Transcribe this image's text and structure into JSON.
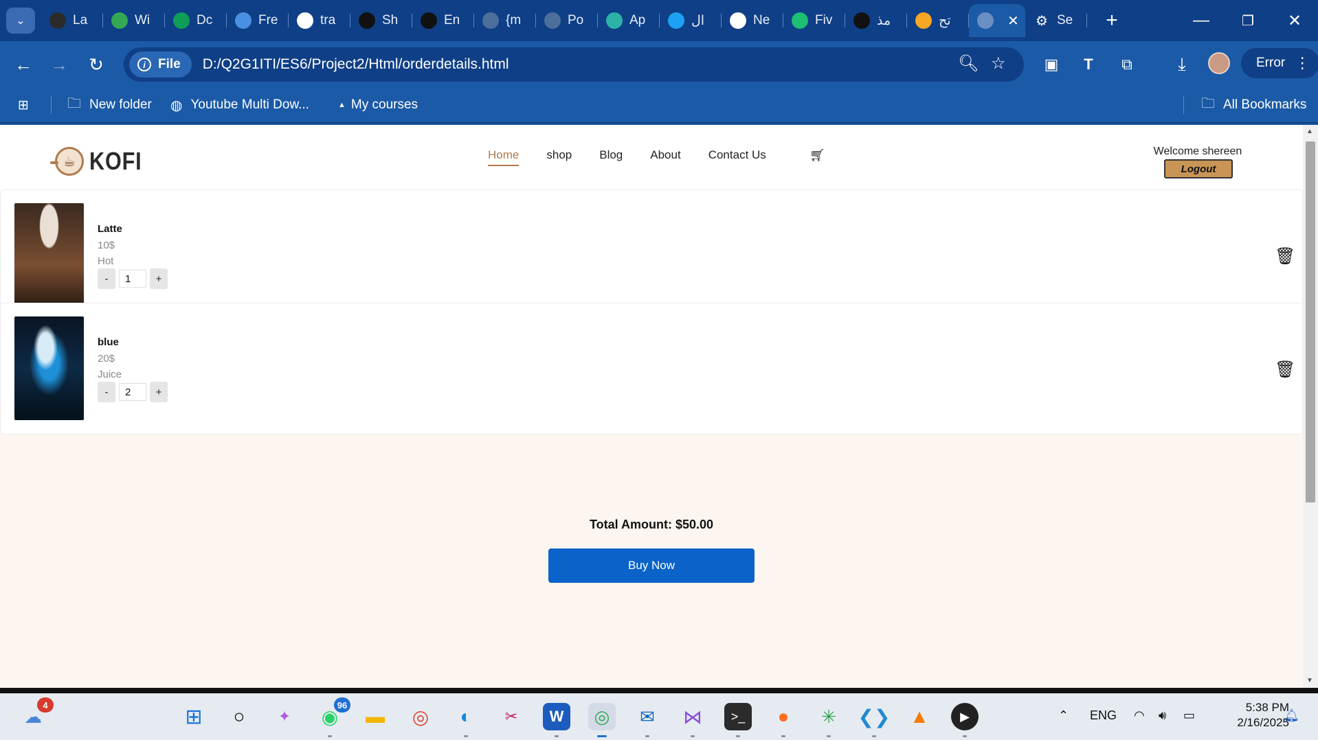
{
  "browser": {
    "tabs": [
      {
        "label": "La",
        "icon": "circle-icon",
        "color": "#2b2b2b"
      },
      {
        "label": "Wi",
        "icon": "drive-icon",
        "color": "#34a853"
      },
      {
        "label": "Dc",
        "icon": "plus-square-icon",
        "color": "#0f9d58"
      },
      {
        "label": "Fre",
        "icon": "doc-icon",
        "color": "#4a90e2"
      },
      {
        "label": "tra",
        "icon": "google-icon",
        "color": "#ffffff"
      },
      {
        "label": "Sh",
        "icon": "upwork-icon",
        "color": "#111111"
      },
      {
        "label": "En",
        "icon": "upwork-icon",
        "color": "#111111"
      },
      {
        "label": "{m",
        "icon": "globe-icon",
        "color": "#4d6f9c"
      },
      {
        "label": "Po",
        "icon": "globe-icon",
        "color": "#4d6f9c"
      },
      {
        "label": "Ap",
        "icon": "app-icon",
        "color": "#2bb3a8"
      },
      {
        "label": "ال",
        "icon": "ring-icon",
        "color": "#1da1f2"
      },
      {
        "label": "Ne",
        "icon": "chrome-icon",
        "color": "#ffffff"
      },
      {
        "label": "Fiv",
        "icon": "fiverr-icon",
        "color": "#1dbf73"
      },
      {
        "label": "مذ",
        "icon": "openai-icon",
        "color": "#111111"
      },
      {
        "label": "تح",
        "icon": "five-icon",
        "color": "#f5a623"
      }
    ],
    "active_tab_close": "✕",
    "extra_tab": "Se",
    "new_tab": "+",
    "address": {
      "site_info_label": "File",
      "url": "D:/Q2G1ITI/ES6/Project2/Html/orderdetails.html"
    },
    "error_label": "Error",
    "bookmarks": [
      {
        "label": "New folder",
        "icon": "folder-icon"
      },
      {
        "label": "Youtube Multi Dow...",
        "icon": "globe-icon"
      },
      {
        "label": "My courses",
        "icon": "triangle-icon"
      }
    ],
    "all_bookmarks": "All Bookmarks"
  },
  "site": {
    "logo_text": "KOFI",
    "nav": [
      "Home",
      "shop",
      "Blog",
      "About",
      "Contact Us"
    ],
    "welcome": "Welcome shereen",
    "logout": "Logout"
  },
  "order": {
    "items": [
      {
        "name": "Latte",
        "price": "10$",
        "type": "Hot",
        "qty": "1",
        "image": "latte-image"
      },
      {
        "name": "blue",
        "price": "20$",
        "type": "Juice",
        "qty": "2",
        "image": "blue-drink-image"
      }
    ],
    "minus": "-",
    "plus": "+",
    "total": "Total Amount: $50.00",
    "buy_now": "Buy Now"
  },
  "taskbar": {
    "weather_badge": "4",
    "whatsapp_badge": "96",
    "language": "ENG",
    "time": "5:38 PM",
    "date": "2/16/2025"
  },
  "colors": {
    "browser_frame": "#1b5aa6",
    "accent": "#b07a4e",
    "buy_button": "#0b63c9",
    "page_bg": "#fdf6f0"
  }
}
